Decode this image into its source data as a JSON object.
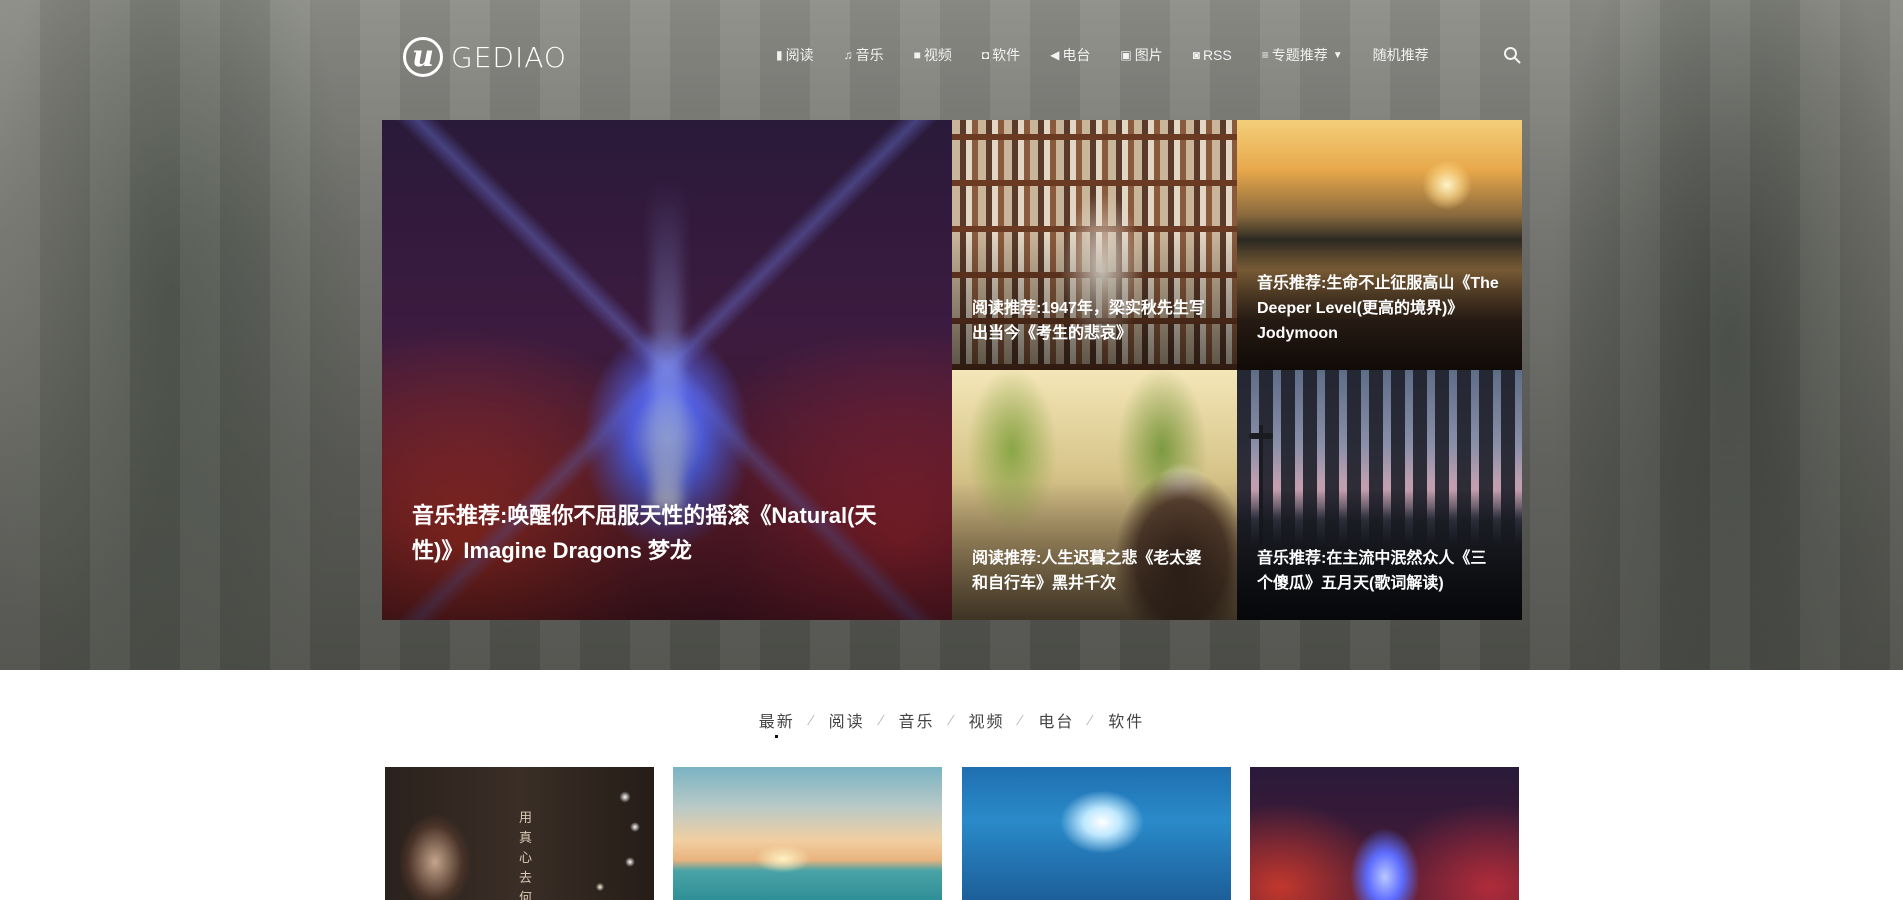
{
  "header": {
    "logo_mark": "u",
    "logo_text": "GEDIAO",
    "nav": [
      {
        "icon": "book-icon",
        "glyph": "▮",
        "label": "阅读"
      },
      {
        "icon": "music-icon",
        "glyph": "♫",
        "label": "音乐"
      },
      {
        "icon": "video-camera-icon",
        "glyph": "■",
        "label": "视频"
      },
      {
        "icon": "software-icon",
        "glyph": "◘",
        "label": "软件"
      },
      {
        "icon": "speaker-icon",
        "glyph": "◀",
        "label": "电台"
      },
      {
        "icon": "image-icon",
        "glyph": "▣",
        "label": "图片"
      },
      {
        "icon": "rss-icon",
        "glyph": "◙",
        "label": "RSS"
      },
      {
        "icon": "list-icon",
        "glyph": "≡",
        "label": "专题推荐",
        "dropdown": true
      },
      {
        "icon": "",
        "glyph": "",
        "label": "随机推荐"
      }
    ],
    "search_icon": "search-icon"
  },
  "featured": [
    {
      "title": "音乐推荐:唤醒你不屈服天性的摇滚《Natural(天性)》Imagine Dragons 梦龙"
    },
    {
      "title": "阅读推荐:1947年，梁实秋先生写出当今《考生的悲哀》"
    },
    {
      "title": "音乐推荐:生命不止征服高山《The Deeper Level(更高的境界)》Jodymoon"
    },
    {
      "title": "阅读推荐:人生迟暮之悲《老太婆和自行车》黑井千次"
    },
    {
      "title": "音乐推荐:在主流中泯然众人《三个傻瓜》五月天(歌词解读)"
    }
  ],
  "tabs": [
    "最新",
    "阅读",
    "音乐",
    "视频",
    "电台",
    "软件"
  ],
  "active_tab": "最新",
  "cards": [
    {
      "overlay_text": "用真心去何"
    }
  ],
  "colors": {
    "text_on_hero": "#ffffff",
    "tab_text": "#444444",
    "page_bg": "#ffffff"
  }
}
